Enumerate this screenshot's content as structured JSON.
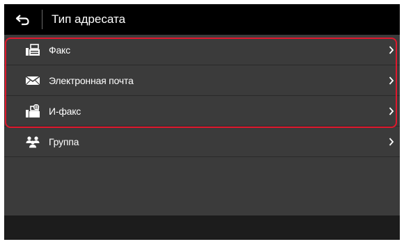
{
  "header": {
    "back_icon": "back-arrow-icon",
    "title": "Тип адресата"
  },
  "items": [
    {
      "label": "Факс",
      "icon": "fax-icon"
    },
    {
      "label": "Электронная почта",
      "icon": "envelope-icon"
    },
    {
      "label": "И-факс",
      "icon": "ifax-icon"
    },
    {
      "label": "Группа",
      "icon": "group-icon"
    }
  ],
  "colors": {
    "highlight": "#e0182d",
    "background": "#3b3b3b",
    "header": "#000000"
  }
}
